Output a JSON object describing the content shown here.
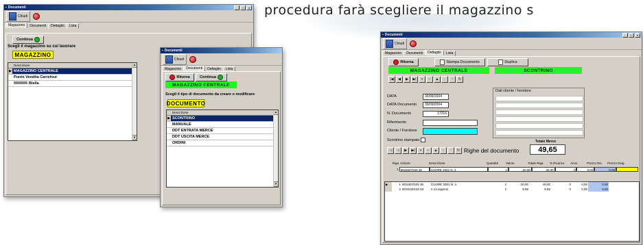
{
  "caption": "procedura farà scegliere il magazzino s",
  "colors": {
    "titlebar": "#0a246a",
    "green": "#24f424",
    "yellow": "#ffff00",
    "cyan": "#00ffff"
  },
  "common": {
    "window_title": "Documenti",
    "close_label": "Chiudi",
    "tabs": [
      "Magazzino",
      "Documenti",
      "Dettaglio",
      "Lista"
    ],
    "win_controls": [
      "_",
      "□",
      "×"
    ]
  },
  "w1": {
    "continue": "Continua",
    "prompt": "Scegli il magazzino su cui lavorare",
    "badge": "MAGAZZINO",
    "grid_header": "Descrizione",
    "rows": [
      "MAGAZZINO CENTRALE",
      "Punto Vendita Carrefour",
      "Biella"
    ]
  },
  "w2": {
    "back": "Ritorna",
    "continue": "Continua",
    "store": "MAGAZZINO CENTRALE",
    "prompt": "Scegli il tipo di documento da creare o modificare",
    "badge": "DOCUMENTO",
    "grid_header": "Descrizione",
    "rows": [
      "SCONTRINO",
      "MANUALE",
      "DDT ENTRATA MERCE",
      "DDT USCITA MERCE",
      "ORDINI"
    ]
  },
  "w3": {
    "back": "Ritorna",
    "print": "Stampa Documento",
    "duplicate": "Duplica",
    "store": "MAGAZZINO CENTRALE",
    "doc_type": "SCONTRINO",
    "labels": {
      "data": "DATA",
      "data_doc": "DATA Documento",
      "n_doc": "N. Documento",
      "rif": "Riferimento",
      "cliente": "Cliente / Fornitore",
      "scontrino": "Scontrino stampato",
      "dati_cliente": "Dati cliente / fornitore",
      "totale": "Totale Merce",
      "righe": "Righe del documento"
    },
    "values": {
      "data": "30/09/2004",
      "data_doc": "30/09/2004",
      "n_doc": "17216",
      "totale": "49,65"
    },
    "edit_header": [
      "Riga",
      "Articolo",
      "Descrizione",
      "Quantità",
      "Valore",
      "Totale Riga",
      "% Ricarico",
      "Arrot.",
      "Prezzo Ric.",
      "Prezzo Diog."
    ],
    "edit_row": [
      "1",
      "8011607025 36",
      "CUORE 2001 N. 4",
      "2",
      "20,00",
      "40,00",
      "0",
      "0,00",
      "0,00",
      ""
    ],
    "rows": [
      [
        "1",
        "8011607025 36",
        "CUORE 2001 N. 4",
        "2",
        "20,00",
        "40,00",
        "0",
        "0,00",
        "0,00"
      ],
      [
        "2",
        "8015150150 93",
        "n.13 argento",
        "1",
        "9,65",
        "9,65",
        "0",
        "0,00",
        "0,00"
      ]
    ]
  }
}
